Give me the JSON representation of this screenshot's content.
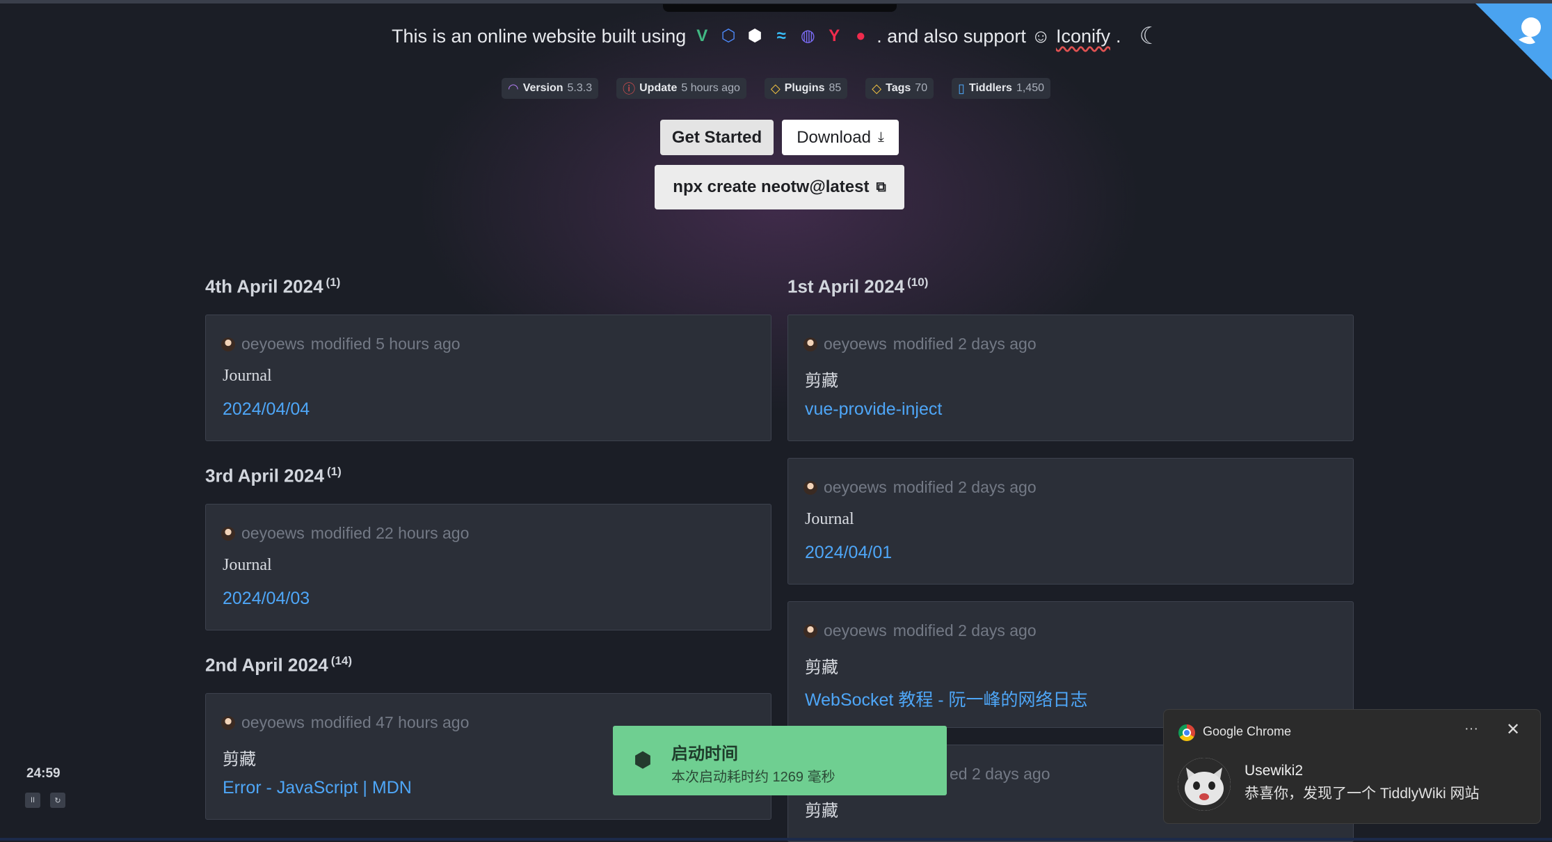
{
  "tagline": {
    "prefix": "This is an online website built using",
    "tech_icons": [
      "vue-icon",
      "vite-icon",
      "tiddlywiki-icon",
      "tailwind-icon",
      "pinia-icon",
      "y-icon",
      "red-circle-icon"
    ],
    "middle": ". and also support ☺",
    "iconify_link": "Iconify",
    "suffix": "."
  },
  "badges": [
    {
      "icon": "gauge-icon",
      "label": "Version",
      "value": "5.3.3",
      "color": "#b07cf0"
    },
    {
      "icon": "alert-circle-icon",
      "label": "Update",
      "value": "5 hours ago",
      "color": "#f05252"
    },
    {
      "icon": "tag-icon",
      "label": "Plugins",
      "value": "85",
      "color": "#f5c542"
    },
    {
      "icon": "tag-icon",
      "label": "Tags",
      "value": "70",
      "color": "#f5c542"
    },
    {
      "icon": "file-icon",
      "label": "Tiddlers",
      "value": "1,450",
      "color": "#4ea6f7"
    }
  ],
  "buttons": {
    "get_started": "Get Started",
    "download": "Download",
    "npx": "npx create neotw@latest"
  },
  "timeline": {
    "left": [
      {
        "date": "4th April 2024",
        "count": "(1)",
        "card": {
          "user": "oeyoews",
          "meta": "modified 5 hours ago",
          "type": "Journal",
          "link": "2024/04/04"
        }
      },
      {
        "date": "3rd April 2024",
        "count": "(1)",
        "card": {
          "user": "oeyoews",
          "meta": "modified 22 hours ago",
          "type": "Journal",
          "link": "2024/04/03"
        }
      },
      {
        "date": "2nd April 2024",
        "count": "(14)",
        "card": {
          "user": "oeyoews",
          "meta": "modified 47 hours ago",
          "type": "剪藏",
          "link": "Error - JavaScript | MDN"
        }
      }
    ],
    "right": {
      "date": "1st April 2024",
      "count": "(10)",
      "cards": [
        {
          "user": "oeyoews",
          "meta": "modified 2 days ago",
          "type": "剪藏",
          "link": "vue-provide-inject"
        },
        {
          "user": "oeyoews",
          "meta": "modified 2 days ago",
          "type": "Journal",
          "link": "2024/04/01"
        },
        {
          "user": "oeyoews",
          "meta": "modified 2 days ago",
          "type": "剪藏",
          "link": "WebSocket 教程 - 阮一峰的网络日志"
        },
        {
          "user": "",
          "meta": "ed 2 days ago",
          "type": "剪藏",
          "link": ""
        }
      ]
    }
  },
  "timer": {
    "value": "24:59",
    "pause": "II",
    "reset": "↻"
  },
  "toast": {
    "title": "启动时间",
    "body": "本次启动耗时约 1269 毫秒"
  },
  "notification": {
    "app": "Google Chrome",
    "more": "···",
    "close": "✕",
    "title": "Usewiki2",
    "body": "恭喜你，发现了一个 TiddlyWiki 网站"
  }
}
